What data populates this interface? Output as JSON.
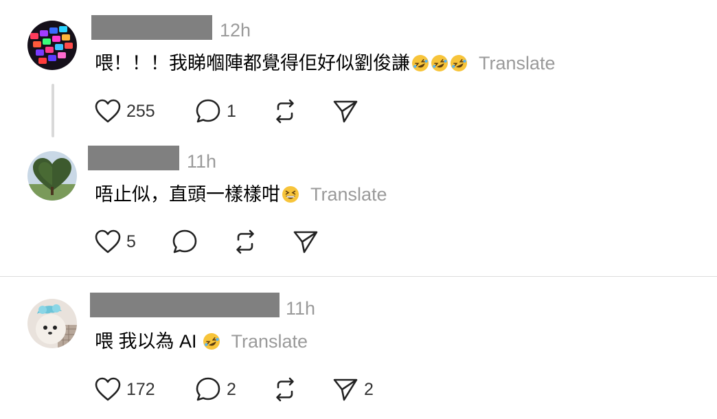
{
  "comments": [
    {
      "time": "12h",
      "text": "喂！！！我睇嗰陣都覺得佢好似劉俊謙",
      "emojis": [
        "rolling-on-floor-laughing",
        "rolling-on-floor-laughing",
        "rolling-on-floor-laughing"
      ],
      "translate_label": "Translate",
      "likes": "255",
      "replies": "1",
      "reposts": "",
      "shares": ""
    },
    {
      "time": "11h",
      "text": "唔止似，直頭一樣樣咁",
      "emojis": [
        "grinning-squinting-face"
      ],
      "translate_label": "Translate",
      "likes": "5",
      "replies": "",
      "reposts": "",
      "shares": ""
    },
    {
      "time": "11h",
      "text": "喂 我以為 AI",
      "emojis": [
        "rolling-on-floor-laughing"
      ],
      "translate_label": "Translate",
      "likes": "172",
      "replies": "2",
      "reposts": "",
      "shares": "2"
    }
  ],
  "icons": {
    "like": "heart-icon",
    "reply": "comment-bubble-icon",
    "repost": "repost-icon",
    "share": "send-icon"
  },
  "colors": {
    "muted_text": "#9a9a9a",
    "redacted_name": "#808080",
    "thread_line": "#d9d9d9"
  }
}
